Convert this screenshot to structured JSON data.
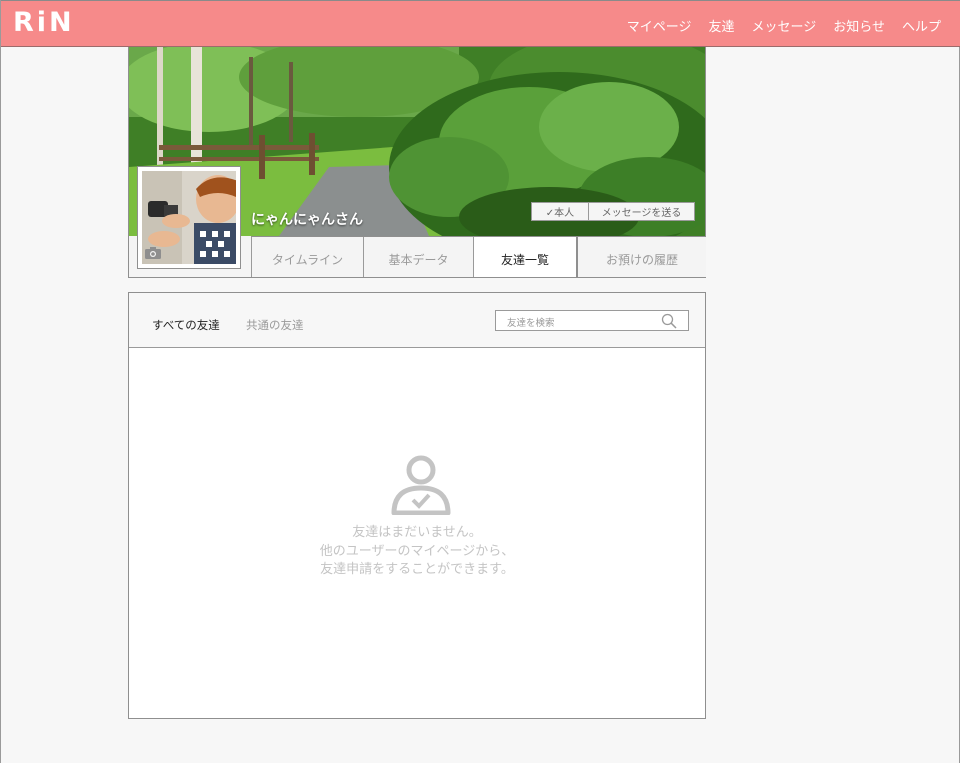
{
  "header": {
    "logo": "RiN",
    "nav": [
      "マイページ",
      "友達",
      "メッセージ",
      "お知らせ",
      "ヘルプ"
    ]
  },
  "profile": {
    "username": "にゃんにゃんさん",
    "self_label": "✓本人",
    "message_button": "メッセージを送る",
    "tabs": [
      "タイムライン",
      "基本データ",
      "友達一覧",
      "お預けの履歴"
    ],
    "active_tab": "友達一覧"
  },
  "friends": {
    "tabs": [
      "すべての友達",
      "共通の友達"
    ],
    "search_placeholder": "友達を検索",
    "empty_lines": [
      "友達はまだいません。",
      "他のユーザーのマイページから、",
      "友達申請をすることができます。"
    ]
  },
  "colors": {
    "header_bg": "#f68a8a",
    "background": "#f7f7f7",
    "border": "#8f8f8f"
  }
}
